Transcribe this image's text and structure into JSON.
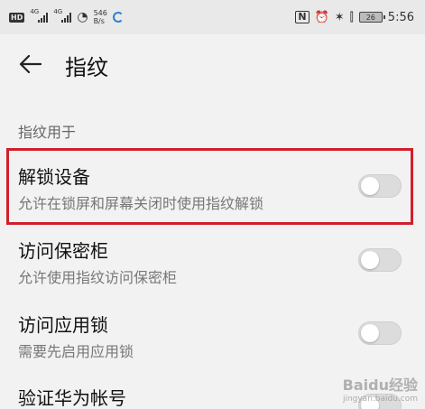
{
  "status_bar": {
    "hd_label": "HD",
    "network_1": "4G",
    "network_2": "4G",
    "speed_value": "546",
    "speed_unit": "B/s",
    "battery": "26",
    "time": "5:56",
    "icons": [
      "hd-icon",
      "signal-icon",
      "signal-icon",
      "wifi-icon",
      "loading-icon",
      "nfc-icon",
      "alarm-icon",
      "bluetooth-icon",
      "vibrate-icon",
      "battery-icon"
    ]
  },
  "app_bar": {
    "title": "指纹",
    "back_icon": "arrow-left-icon"
  },
  "section": {
    "header": "指纹用于"
  },
  "settings": [
    {
      "title": "解锁设备",
      "subtitle": "允许在锁屏和屏幕关闭时使用指纹解锁",
      "enabled": false
    },
    {
      "title": "访问保密柜",
      "subtitle": "允许使用指纹访问保密柜",
      "enabled": false
    },
    {
      "title": "访问应用锁",
      "subtitle": "需要先启用应用锁",
      "enabled": false
    },
    {
      "title": "验证华为帐号",
      "enabled": false
    }
  ],
  "highlight_color": "#d11f2a",
  "watermark": {
    "main": "Baidu经验",
    "sub": "jingyan.baidu.com"
  }
}
